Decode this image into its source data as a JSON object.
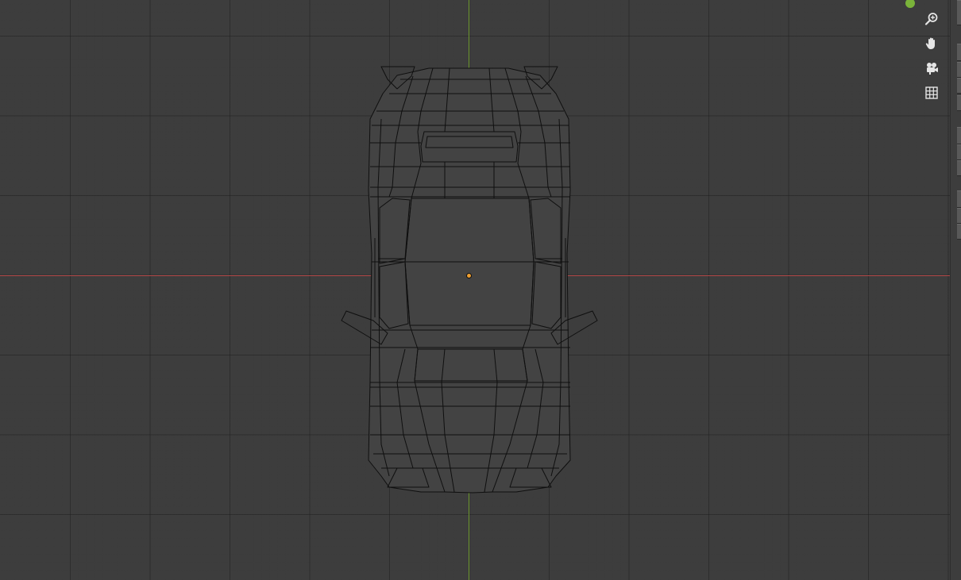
{
  "app": "3D Viewport",
  "colors": {
    "background": "#3d3d3d",
    "axis_x": "#b34848",
    "axis_y": "#6e9a2f",
    "wire": "#0f0f0f",
    "mesh_fill": "#434343",
    "origin": "#f0a030",
    "gizmo_dot": "#7ab33a",
    "icon": "#e6e6e6"
  },
  "navigation": {
    "buttons": [
      {
        "name": "zoom-icon"
      },
      {
        "name": "pan-hand-icon"
      },
      {
        "name": "camera-view-icon"
      },
      {
        "name": "ortho-grid-icon"
      }
    ]
  }
}
